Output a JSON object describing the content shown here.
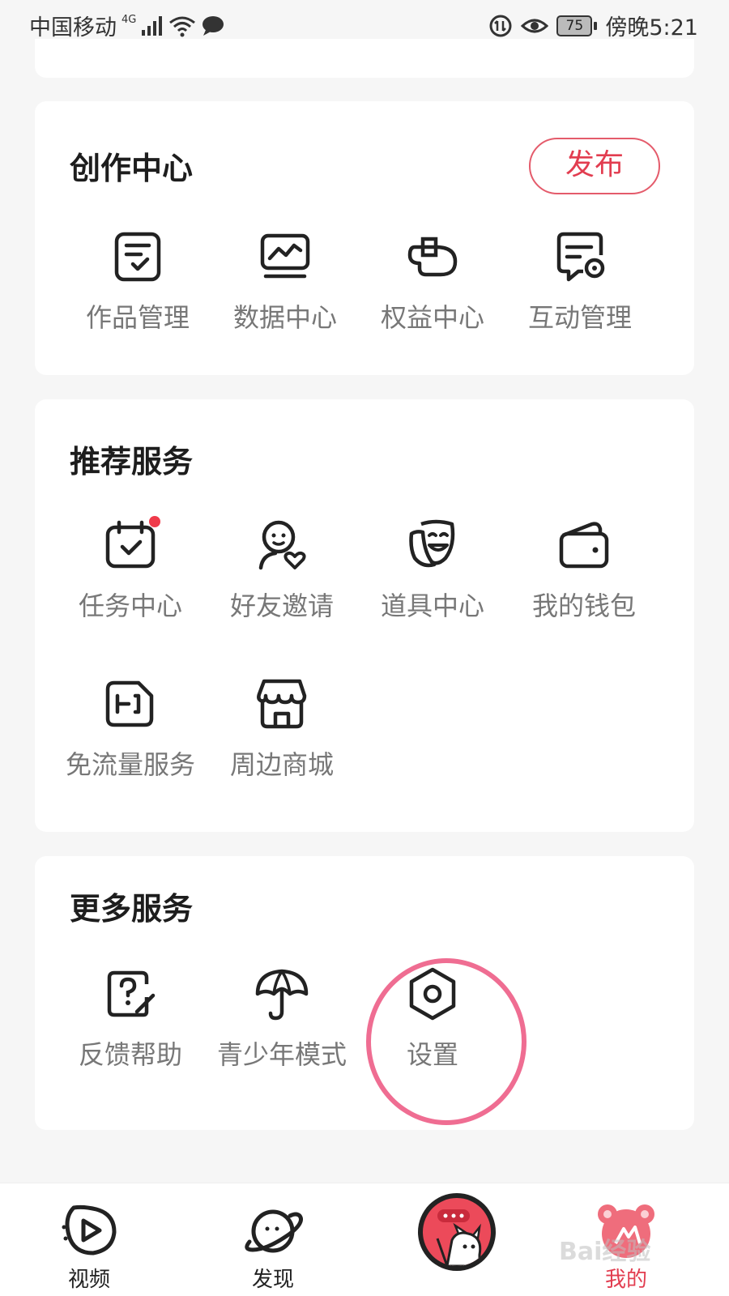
{
  "status_bar": {
    "carrier": "中国移动",
    "network": "4G",
    "battery": "75",
    "time": "傍晚5:21"
  },
  "creation_center": {
    "title": "创作中心",
    "publish_label": "发布",
    "items": [
      {
        "label": "作品管理",
        "icon": "works-manage-icon"
      },
      {
        "label": "数据中心",
        "icon": "data-chart-icon"
      },
      {
        "label": "权益中心",
        "icon": "benefits-icon"
      },
      {
        "label": "互动管理",
        "icon": "interaction-manage-icon"
      }
    ]
  },
  "recommended_services": {
    "title": "推荐服务",
    "items": [
      {
        "label": "任务中心",
        "icon": "task-calendar-icon",
        "badge": "red-dot"
      },
      {
        "label": "好友邀请",
        "icon": "friend-invite-icon"
      },
      {
        "label": "道具中心",
        "icon": "props-mask-icon"
      },
      {
        "label": "我的钱包",
        "icon": "wallet-icon"
      },
      {
        "label": "免流量服务",
        "icon": "sim-card-icon"
      },
      {
        "label": "周边商城",
        "icon": "shop-icon"
      }
    ]
  },
  "more_services": {
    "title": "更多服务",
    "items": [
      {
        "label": "反馈帮助",
        "icon": "feedback-help-icon"
      },
      {
        "label": "青少年模式",
        "icon": "umbrella-icon"
      },
      {
        "label": "设置",
        "icon": "settings-hexagon-icon"
      }
    ]
  },
  "tabbar": {
    "tabs": [
      {
        "label": "视频",
        "icon": "video-play-icon"
      },
      {
        "label": "发现",
        "icon": "planet-icon"
      },
      {
        "label": "",
        "icon": "center-create-icon"
      },
      {
        "label": "我的",
        "icon": "profile-bear-icon",
        "active": true
      }
    ]
  },
  "watermark": "Bai经验",
  "colors": {
    "accent": "#e23d50",
    "highlight_ring": "#ef6d92",
    "background": "#f6f6f6",
    "card": "#ffffff"
  }
}
